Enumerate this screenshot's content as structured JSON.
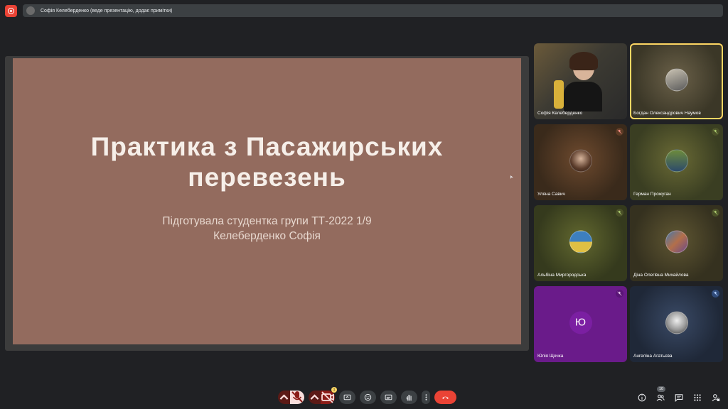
{
  "topbar": {
    "presenter_text": "Софія Келеберденко (веде презентацію, додає примітки)"
  },
  "slide": {
    "title": "Практика з Пасажирських перевезень",
    "subtitle_line1": "Підготувала студентка групи ТТ-2022 1/9",
    "subtitle_line2": "Келеберденко Софія",
    "background_color": "#936b5e"
  },
  "participants": [
    {
      "name": "Софія Келеберденко",
      "icon": "camera-video",
      "muted": false
    },
    {
      "name": "Богдан Олександрович Наумов",
      "icon": "avatar-photo",
      "muted": false,
      "active_speaker": true
    },
    {
      "name": "Уляна Савич",
      "icon": "avatar-photo",
      "muted": true
    },
    {
      "name": "Герман Прожуган",
      "icon": "avatar-photo",
      "muted": true
    },
    {
      "name": "Альбіна Миргородська",
      "icon": "avatar-photo",
      "muted": true
    },
    {
      "name": "Діна Олегівна Михайлова",
      "icon": "avatar-photo",
      "muted": true
    },
    {
      "name": "Юлія Щочка",
      "avatar_letter": "Ю",
      "muted": true
    },
    {
      "name": "Ангеліна Агатьєва",
      "icon": "avatar-photo",
      "muted": true
    }
  ],
  "controls": {
    "camera_badge": "1",
    "people_count": "10"
  },
  "colors": {
    "background": "#202124",
    "record": "#ea4335",
    "end_call": "#ea4335",
    "speaker_border": "#fdd663"
  }
}
